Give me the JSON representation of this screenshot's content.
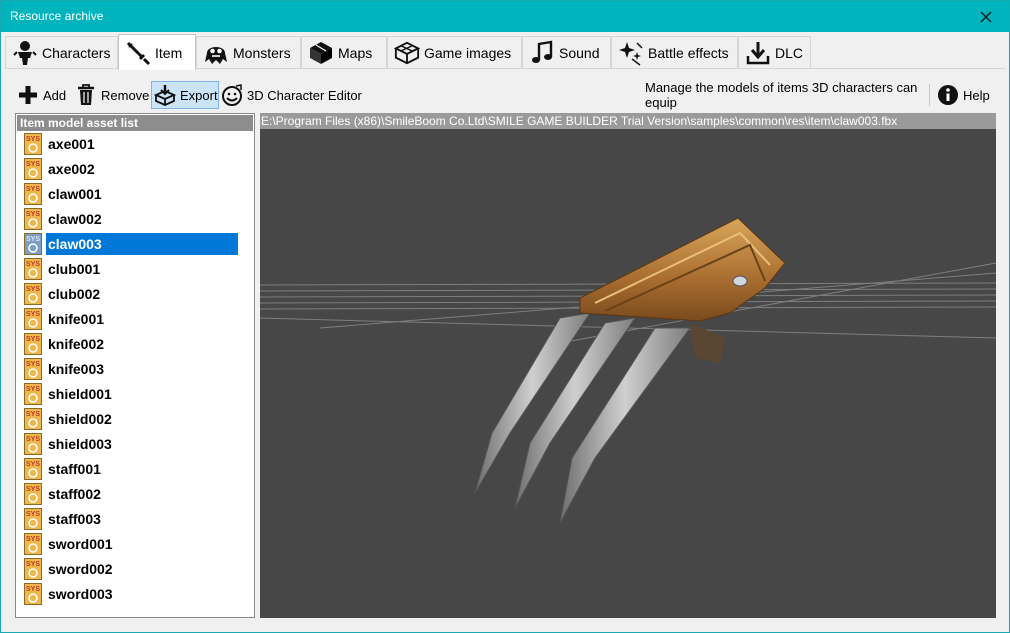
{
  "window": {
    "title": "Resource archive"
  },
  "tabs": [
    {
      "label": "Characters",
      "icon": "character-icon"
    },
    {
      "label": "Item",
      "icon": "sword-icon"
    },
    {
      "label": "Monsters",
      "icon": "monster-icon"
    },
    {
      "label": "Maps",
      "icon": "map-icon"
    },
    {
      "label": "Game images",
      "icon": "game-images-icon"
    },
    {
      "label": "Sound",
      "icon": "music-note-icon"
    },
    {
      "label": "Battle effects",
      "icon": "sparkle-icon"
    },
    {
      "label": "DLC",
      "icon": "download-icon"
    }
  ],
  "toolbar": {
    "add": "Add",
    "remove": "Remove",
    "export": "Export",
    "editor": "3D Character Editor",
    "description": "Manage the models of items 3D characters can equip",
    "help": "Help"
  },
  "list": {
    "header": "Item model asset list",
    "items": [
      "axe001",
      "axe002",
      "claw001",
      "claw002",
      "claw003",
      "club001",
      "club002",
      "knife001",
      "knife002",
      "knife003",
      "shield001",
      "shield002",
      "shield003",
      "staff001",
      "staff002",
      "staff003",
      "sword001",
      "sword002",
      "sword003"
    ],
    "selected": "claw003",
    "badge": "SYS"
  },
  "viewport": {
    "path": "E:\\Program Files (x86)\\SmileBoom Co.Ltd\\SMILE GAME BUILDER Trial Version\\samples\\common\\res\\item\\claw003.fbx"
  },
  "colors": {
    "titlebar": "#00b4bd",
    "selection": "#0078d7",
    "viewport": "#474747"
  }
}
